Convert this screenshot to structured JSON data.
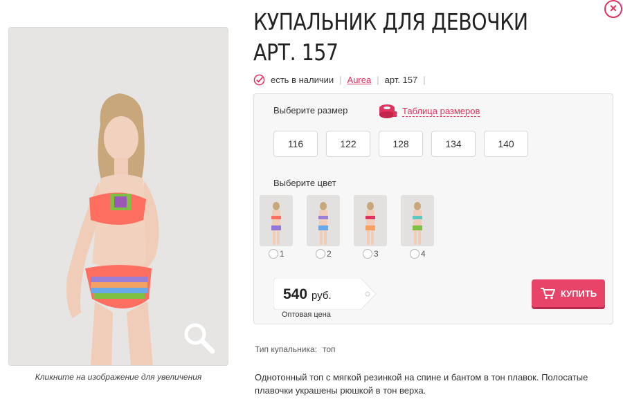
{
  "header": {
    "close_symbol": "×"
  },
  "product": {
    "title": "КУПАЛЬНИК ДЛЯ ДЕВОЧКИ АРТ. 157",
    "availability": "есть в наличии",
    "brand": "Aurea",
    "article": "арт. 157"
  },
  "gallery": {
    "caption": "Кликните на изображение для увеличения",
    "zoom_icon": "magnifier-icon"
  },
  "size_selector": {
    "label": "Выберите размер",
    "size_table_link": "Таблица размеров",
    "sizes": [
      "116",
      "122",
      "128",
      "134",
      "140"
    ]
  },
  "color_selector": {
    "label": "Выберите цвет",
    "options": [
      "1",
      "2",
      "3",
      "4"
    ]
  },
  "price": {
    "amount": "540",
    "currency": "руб.",
    "note": "Оптовая цена"
  },
  "buy_button": {
    "label": "КУПИТЬ",
    "icon": "cart-icon"
  },
  "attributes": {
    "label": "Тип купальника:",
    "value": "топ"
  },
  "description": "Однотонный топ с мягкой резинкой на спине и бантом в тон плавок. Полосатые плавочки украшены рюшкой в тон верха.",
  "colors": {
    "accent": "#e0325e",
    "buy_button": "#e84369",
    "panel_bg": "#f7f7f7"
  }
}
